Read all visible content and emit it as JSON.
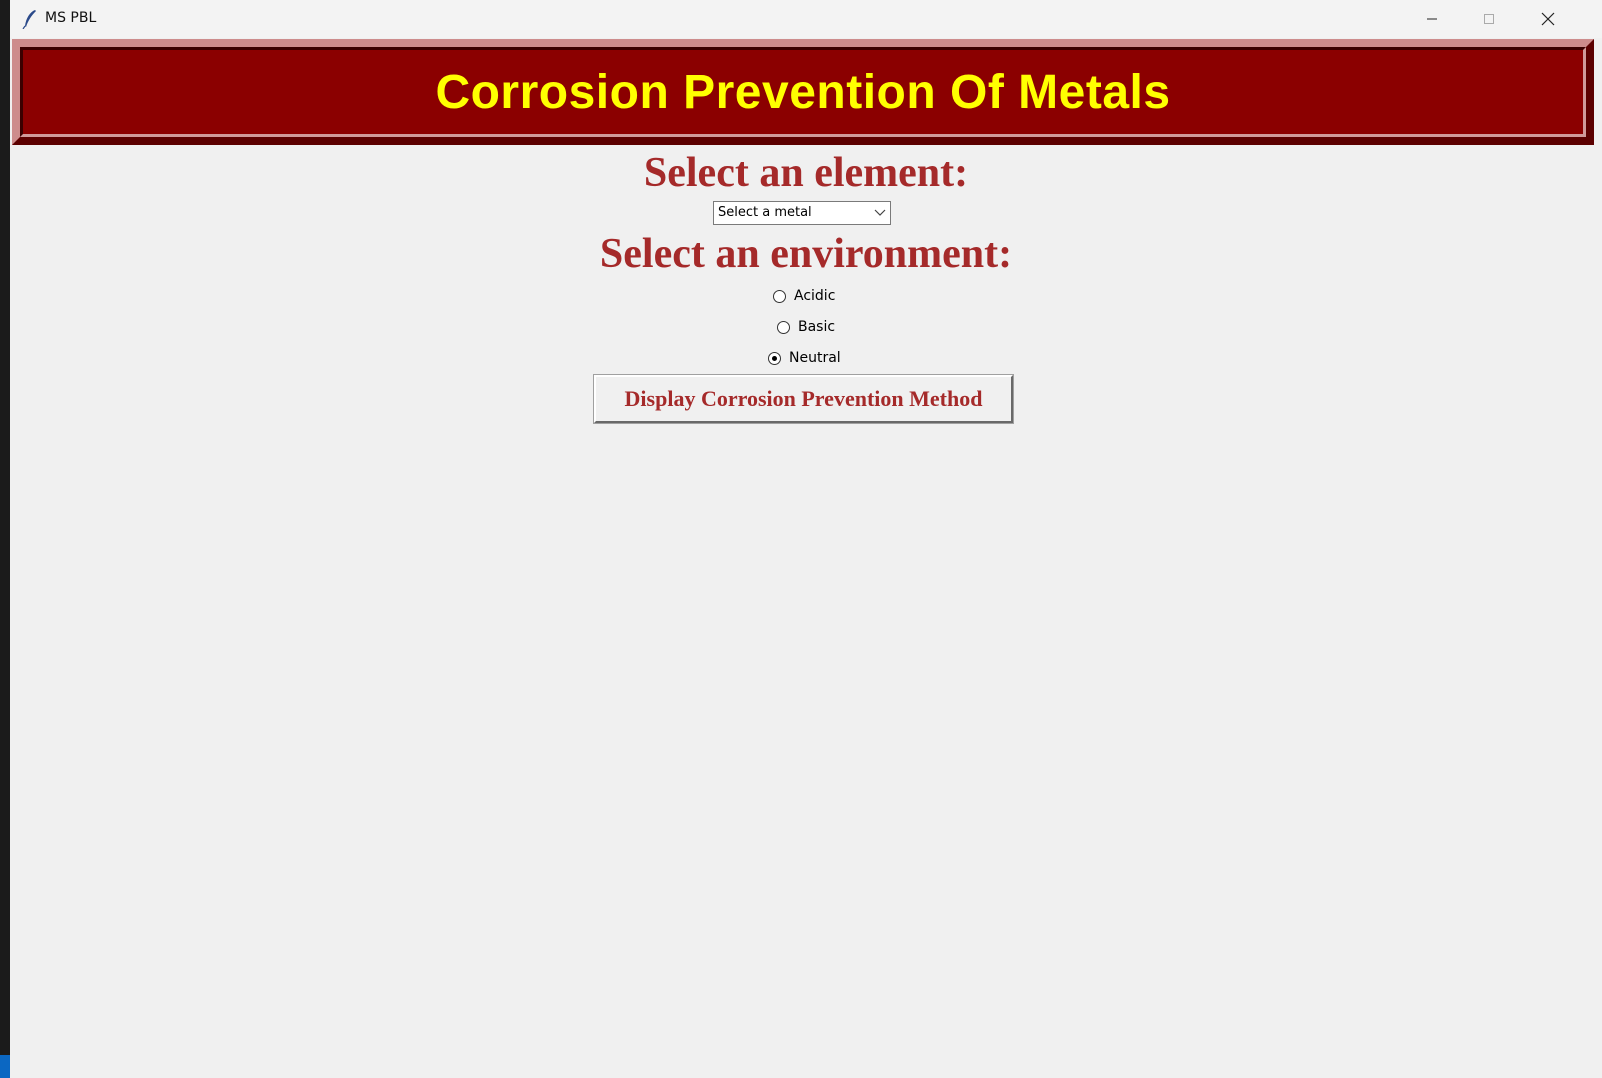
{
  "window": {
    "title": "MS PBL",
    "controls": {
      "minimize_icon": "minimize-icon",
      "maximize_icon": "maximize-icon",
      "close_icon": "close-icon"
    }
  },
  "banner": {
    "title": "Corrosion Prevention Of Metals",
    "background_color": "#8b0000",
    "text_color": "#ffff00"
  },
  "element_section": {
    "heading": "Select an element:",
    "combobox": {
      "value": "Select a metal"
    }
  },
  "environment_section": {
    "heading": "Select an environment:",
    "options": [
      {
        "label": "Acidic",
        "checked": false
      },
      {
        "label": "Basic",
        "checked": false
      },
      {
        "label": "Neutral",
        "checked": true
      }
    ]
  },
  "action": {
    "button_label": "Display Corrosion Prevention Method"
  },
  "colors": {
    "heading": "#a52a2a",
    "background": "#f0f0f0"
  }
}
